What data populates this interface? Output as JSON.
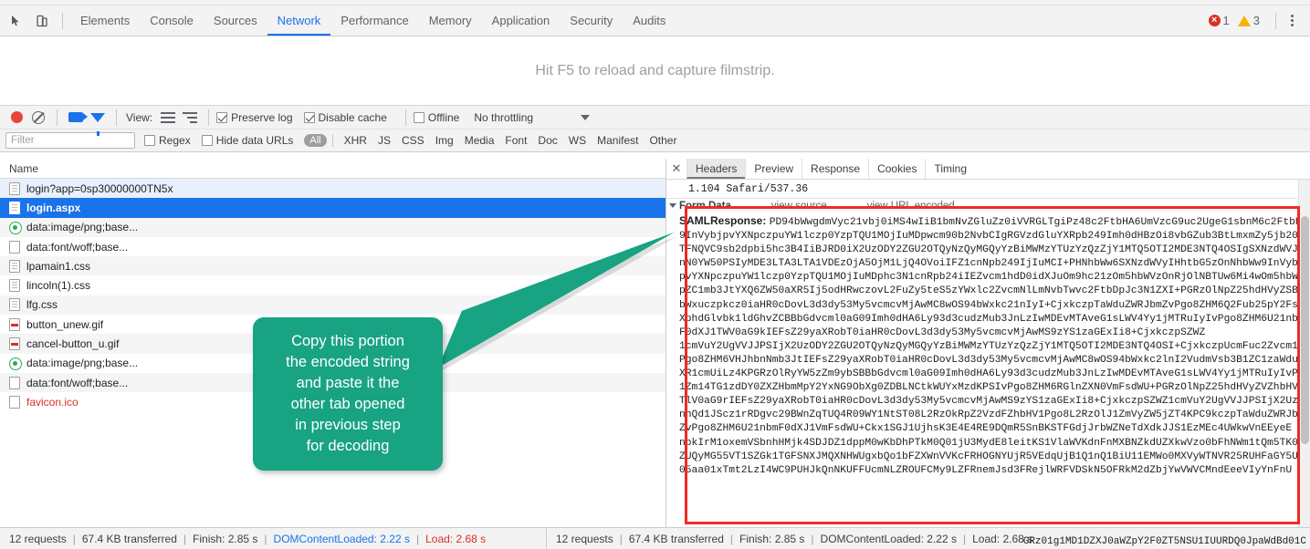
{
  "devtools": {
    "panel_tabs": [
      {
        "label": "Elements",
        "active": false
      },
      {
        "label": "Console",
        "active": false
      },
      {
        "label": "Sources",
        "active": false
      },
      {
        "label": "Network",
        "active": true
      },
      {
        "label": "Performance",
        "active": false
      },
      {
        "label": "Memory",
        "active": false
      },
      {
        "label": "Application",
        "active": false
      },
      {
        "label": "Security",
        "active": false
      },
      {
        "label": "Audits",
        "active": false
      }
    ],
    "error_count": "1",
    "warning_count": "3",
    "inspect_icon": "inspect-element-icon",
    "device_icon": "toggle-device-toolbar-icon",
    "menu_icon": "kebab-menu-icon"
  },
  "filmstrip": {
    "message": "Hit F5 to reload and capture filmstrip."
  },
  "network_toolbar": {
    "record_icon": "record-icon",
    "clear_icon": "clear-icon",
    "camera_icon": "capture-screenshots-icon",
    "filter_icon": "filter-icon",
    "view_label": "View:",
    "view_list_icon": "list-view-icon",
    "view_waterfall_icon": "waterfall-view-icon",
    "preserve_log_label": "Preserve log",
    "preserve_log_checked": true,
    "disable_cache_label": "Disable cache",
    "disable_cache_checked": true,
    "offline_label": "Offline",
    "offline_checked": false,
    "throttling_value": "No throttling",
    "throttling_caret_icon": "chevron-down-icon"
  },
  "filter_bar": {
    "filter_placeholder": "Filter",
    "filter_value": "",
    "regex_label": "Regex",
    "regex_checked": false,
    "hide_data_urls_label": "Hide data URLs",
    "hide_data_urls_checked": false,
    "types": [
      "All",
      "XHR",
      "JS",
      "CSS",
      "Img",
      "Media",
      "Font",
      "Doc",
      "WS",
      "Manifest",
      "Other"
    ],
    "active_type": "All"
  },
  "requests": {
    "column_header": "Name",
    "rows": [
      {
        "name": "login?app=0sp30000000TN5x",
        "icon": "document-icon",
        "state": "hover"
      },
      {
        "name": "login.aspx",
        "icon": "document-icon",
        "state": "selected"
      },
      {
        "name": "data:image/png;base...",
        "icon": "image-icon",
        "state": "alt"
      },
      {
        "name": "data:font/woff;base...",
        "icon": "font-icon",
        "state": "normal"
      },
      {
        "name": "lpamain1.css",
        "icon": "stylesheet-icon",
        "state": "alt"
      },
      {
        "name": "lincoln(1).css",
        "icon": "stylesheet-icon",
        "state": "normal"
      },
      {
        "name": "lfg.css",
        "icon": "stylesheet-icon",
        "state": "alt"
      },
      {
        "name": "button_unew.gif",
        "icon": "gif-icon",
        "state": "normal"
      },
      {
        "name": "cancel-button_u.gif",
        "icon": "gif-icon",
        "state": "alt"
      },
      {
        "name": "data:image/png;base...",
        "icon": "image-icon",
        "state": "normal"
      },
      {
        "name": "data:font/woff;base...",
        "icon": "font-icon",
        "state": "alt"
      },
      {
        "name": "favicon.ico",
        "icon": "favicon-icon",
        "state": "failed"
      }
    ]
  },
  "details": {
    "close_icon": "close-icon",
    "tabs": [
      {
        "label": "Headers",
        "active": true
      },
      {
        "label": "Preview",
        "active": false
      },
      {
        "label": "Response",
        "active": false
      },
      {
        "label": "Cookies",
        "active": false
      },
      {
        "label": "Timing",
        "active": false
      }
    ],
    "user_agent_tail": "1.104 Safari/537.36",
    "form_data_label": "Form Data",
    "view_source_label": "view source",
    "view_url_encoded_label": "view URL encoded",
    "param_name": "SAMLResponse:",
    "saml_lines": [
      "PD94bWwgdmVyc21vbj0iMS4wIiB1bmNvZGluZz0iVVRGLTgiPz48c2FtbHA6UmVzcG9uc2UgeG1sbnM6c2FtbHA",
      "9InVybjpvYXNpczpuYW1lczp0YzpTQU1MOjIuMDpwcm90b2NvbCIgRGVzdGluYXRpb249Imh0dHBzOi8vbGZub3BtLmxmZy5jb20",
      "TFNQVC9sb2dpbi5hc3B4IiBJRD0iX2UzODY2ZGU2OTQyNzQyMGQyYzBiMWMzYTUzYzQzZjY1MTQ5OTI2MDE3NTQ4OSIgSXNzdWVJ",
      "nN0YW50PSIyMDE3LTA3LTA1VDEzOjA5OjM1LjQ4OVoiIFZ1cnNpb249IjIuMCI+PHNhbWw6SXNzdWVyIHhtbG5zOnNhbWw9InVyb",
      "pvYXNpczpuYW1lczp0YzpTQU1MOjIuMDphc3N1cnRpb24iIEZvcm1hdD0idXJuOm9hc21zOm5hbWVzOnRjOlNBTUw6Mi4wOm5hbW",
      "pZC1mb3JtYXQ6ZW50aXR5Ij5odHRwczovL2FuZy5teS5zYWxlc2ZvcmNlLmNvbTwvc2FtbDpJc3N1ZXI+PGRzOlNpZ25hdHVyZSB",
      "bWxuczpkcz0iaHR0cDovL3d3dy53My5vcmcvMjAwMC8wOS94bWxkc21nIyI+CjxkczpTaWduZWRJbmZvPgo8ZHM6Q2Fub25pY2Fsa",
      "XphdGlvbk1ldGhvZCBBbGdvcml0aG09Imh0dHA6Ly93d3cudzMub3JnLzIwMDEvMTAveG1sLWV4Yy1jMTRuIyIvPgo8ZHM6U21nbm",
      "F0dXJ1TWV0aG9kIEFsZ29yaXRobT0iaHR0cDovL3d3dy53My5vcmcvMjAwMS9zYS1zaGExIi8+CjxkczpSZWZ",
      "1cmVuY2UgVVJJPSIjX2UzODY2ZGU2OTQyNzQyMGQyYzBiMWMzYTUzYzQzZjY1MTQ5OTI2MDE3NTQ4OSI+CjxkczpUcmFuc2Zvcm1z",
      "Pgo8ZHM6VHJhbnNmb3JtIEFsZ29yaXRobT0iaHR0cDovL3d3dy53My5vcmcvMjAwMC8wOS94bWxkc2lnI2VudmVsb3B1ZC1zaWdudX",
      "XR1cmUiLz4KPGRzOlRyYW5zZm9ybSBBbGdvcml0aG09Imh0dHA6Ly93d3cudzMub3JnLzIwMDEvMTAveG1sLWV4Yy1jMTRuIyIvPg",
      "1Zm14TG1zdDY0ZXZHbmMpY2YxNG9ObXg0ZDBLNCtkWUYxMzdKPSIvPgo8ZHM6RGlnZXN0VmFsdWU+PGRzOlNpZ25hdHVyZVZhbHV",
      "TlV0aG9rIEFsZ29yaXRobT0iaHR0cDovL3d3dy53My5vcmcvMjAwMS9zYS1zaGExIi8+CjxkczpSZWZ1cmVuY2UgVVJJPSIjX2Uz",
      "nhQd1JScz1rRDgvc29BWnZqTUQ4R09WY1NtST08L2RzOkRpZ2VzdFZhbHV1Pgo8L2RzOlJ1ZmVyZW5jZT4KPC9kczpTaWduZWRJbm",
      "ZvPgo8ZHM6U21nbmF0dXJ1VmFsdWU+Ckx1SGJ1UjhsK3E4E4RE9DQmR5SnBKSTFGdjJrbWZNeTdXdkJJS1EzMEc4UWkwVnEEyeE",
      "nbkIrM1oxemVSbnhHMjk4SDJDZ1dppM0wKbDhPTkM0Q01jU3MydE8leitKS1VlaWVKdnFnMXBNZkdUZXkwVzo0bFhNWm1tQm5TK0w",
      "ZUQyMG55VT1SZGk1TGFSNXJMQXNHWUgxbQo1bFZXWnVVKcFRHOGNYUjR5VEdqUjB1Q1nQ1BiU11EMWo0MXVyWTNVR25RUHFaGY5U",
      "05aa01xTmt2LzI4WC9PUHJkQnNKUFFUcmNLZROUFCMy9LZFRnemJsd3FRejlWRFVDSkN5OFRkM2dZbjYwVWVCMndEeeVIyYnFnU"
    ],
    "scrollbar_icon": "vertical-scrollbar"
  },
  "callout": {
    "lines": [
      "Copy this portion",
      "the encoded string",
      "and paste it the",
      "other tab opened",
      "in previous step",
      "for decoding"
    ],
    "color": "#18a383"
  },
  "highlight_box": {
    "color": "#ee2b24"
  },
  "status": {
    "requests": "12 requests",
    "transferred": "67.4 KB transferred",
    "finish": "Finish: 2.85 s",
    "domcontentloaded": "DOMContentLoaded: 2.22 s",
    "load": "Load: 2.68 s"
  },
  "tail_text": "GRz01g1MD1DZXJ0aWZpY2F0ZT5NSU1IUURDQ0JpaWdBd01C",
  "colors": {
    "accent": "#1a73e8",
    "error": "#d93025",
    "warning": "#f4b400",
    "callout": "#18a383",
    "box": "#ee2b24"
  }
}
